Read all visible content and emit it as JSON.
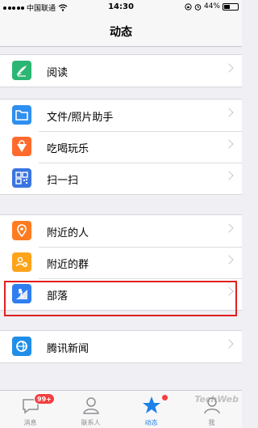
{
  "status_bar": {
    "carrier": "中国联通",
    "time": "14:30",
    "battery": "44%",
    "battery_level": 0.44
  },
  "nav": {
    "title": "动态"
  },
  "groups": [
    {
      "items": [
        {
          "label": "阅读",
          "icon": "reading-icon"
        }
      ]
    },
    {
      "items": [
        {
          "label": "文件/照片助手",
          "icon": "folder-icon"
        },
        {
          "label": "吃喝玩乐",
          "icon": "food-icon"
        },
        {
          "label": "扫一扫",
          "icon": "qr-scan-icon"
        }
      ]
    },
    {
      "items": [
        {
          "label": "附近的人",
          "icon": "location-pin-icon"
        },
        {
          "label": "附近的群",
          "icon": "group-people-icon"
        },
        {
          "label": "部落",
          "icon": "tribe-icon"
        }
      ]
    },
    {
      "items": [
        {
          "label": "腾讯新闻",
          "icon": "news-icon"
        }
      ]
    }
  ],
  "colors": {
    "reading": "#2bb673",
    "folder": "#2f8ff0",
    "food": "#ff6a2c",
    "scan": "#3b75e0",
    "nearby_people": "#ff7b21",
    "nearby_group": "#ffa31a",
    "tribe": "#2f7ef0",
    "news": "#1f8ee8",
    "active_tab": "#1d80e8",
    "badge": "#f43f3f",
    "highlight": "#e02020"
  },
  "tabs": [
    {
      "label": "消息",
      "badge": "99+"
    },
    {
      "label": "联系人"
    },
    {
      "label": "动态"
    },
    {
      "label": "我"
    }
  ],
  "watermark": "TechWeb"
}
